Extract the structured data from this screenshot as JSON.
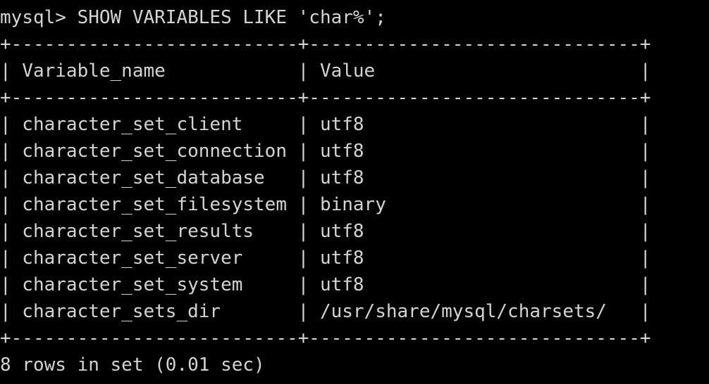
{
  "terminal": {
    "prompt": "mysql> ",
    "command": "SHOW VARIABLES LIKE 'char%';",
    "table": {
      "separator": "+--------------------------+------------------------------+",
      "header": "| Variable_name            | Value                        |",
      "columns": [
        "Variable_name",
        "Value"
      ],
      "rows": [
        {
          "text": "| character_set_client     | utf8                         |",
          "name": "character_set_client",
          "value": "utf8"
        },
        {
          "text": "| character_set_connection | utf8                         |",
          "name": "character_set_connection",
          "value": "utf8"
        },
        {
          "text": "| character_set_database   | utf8                         |",
          "name": "character_set_database",
          "value": "utf8"
        },
        {
          "text": "| character_set_filesystem | binary                       |",
          "name": "character_set_filesystem",
          "value": "binary"
        },
        {
          "text": "| character_set_results    | utf8                         |",
          "name": "character_set_results",
          "value": "utf8"
        },
        {
          "text": "| character_set_server     | utf8                         |",
          "name": "character_set_server",
          "value": "utf8"
        },
        {
          "text": "| character_set_system     | utf8                         |",
          "name": "character_set_system",
          "value": "utf8"
        },
        {
          "text": "| character_sets_dir       | /usr/share/mysql/charsets/   |",
          "name": "character_sets_dir",
          "value": "/usr/share/mysql/charsets/"
        }
      ]
    },
    "footer": "8 rows in set (0.01 sec)",
    "colors": {
      "background": "#000000",
      "foreground": "#d4d4d4"
    }
  }
}
